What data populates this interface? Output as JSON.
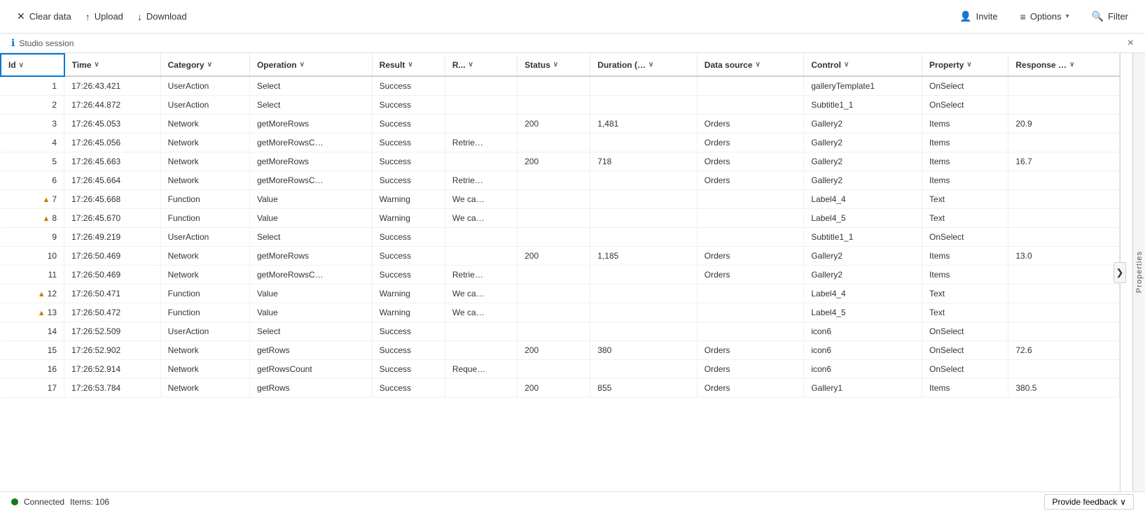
{
  "toolbar": {
    "clear_data_label": "Clear data",
    "upload_label": "Upload",
    "download_label": "Download",
    "invite_label": "Invite",
    "options_label": "Options",
    "filter_label": "Filter"
  },
  "session": {
    "label": "Studio session",
    "close_title": "Close"
  },
  "table": {
    "columns": [
      {
        "key": "id",
        "label": "Id",
        "sortable": true
      },
      {
        "key": "time",
        "label": "Time",
        "sortable": true
      },
      {
        "key": "category",
        "label": "Category",
        "sortable": true
      },
      {
        "key": "operation",
        "label": "Operation",
        "sortable": true
      },
      {
        "key": "result",
        "label": "Result",
        "sortable": true
      },
      {
        "key": "r",
        "label": "R...",
        "sortable": true
      },
      {
        "key": "status",
        "label": "Status",
        "sortable": true
      },
      {
        "key": "duration",
        "label": "Duration (…",
        "sortable": true
      },
      {
        "key": "datasource",
        "label": "Data source",
        "sortable": true
      },
      {
        "key": "control",
        "label": "Control",
        "sortable": true
      },
      {
        "key": "property",
        "label": "Property",
        "sortable": true
      },
      {
        "key": "response",
        "label": "Response …",
        "sortable": true
      }
    ],
    "rows": [
      {
        "id": 1,
        "warn": false,
        "time": "17:26:43.421",
        "category": "UserAction",
        "operation": "Select",
        "result": "Success",
        "r": "",
        "status": "",
        "duration": "",
        "datasource": "",
        "control": "galleryTemplate1",
        "property": "OnSelect",
        "response": ""
      },
      {
        "id": 2,
        "warn": false,
        "time": "17:26:44.872",
        "category": "UserAction",
        "operation": "Select",
        "result": "Success",
        "r": "",
        "status": "",
        "duration": "",
        "datasource": "",
        "control": "Subtitle1_1",
        "property": "OnSelect",
        "response": ""
      },
      {
        "id": 3,
        "warn": false,
        "time": "17:26:45.053",
        "category": "Network",
        "operation": "getMoreRows",
        "result": "Success",
        "r": "",
        "status": "200",
        "duration": "1,481",
        "datasource": "Orders",
        "control": "Gallery2",
        "property": "Items",
        "response": "20.9"
      },
      {
        "id": 4,
        "warn": false,
        "time": "17:26:45.056",
        "category": "Network",
        "operation": "getMoreRowsC…",
        "result": "Success",
        "r": "Retrie…",
        "status": "",
        "duration": "",
        "datasource": "Orders",
        "control": "Gallery2",
        "property": "Items",
        "response": ""
      },
      {
        "id": 5,
        "warn": false,
        "time": "17:26:45.663",
        "category": "Network",
        "operation": "getMoreRows",
        "result": "Success",
        "r": "",
        "status": "200",
        "duration": "718",
        "datasource": "Orders",
        "control": "Gallery2",
        "property": "Items",
        "response": "16.7"
      },
      {
        "id": 6,
        "warn": false,
        "time": "17:26:45.664",
        "category": "Network",
        "operation": "getMoreRowsC…",
        "result": "Success",
        "r": "Retrie…",
        "status": "",
        "duration": "",
        "datasource": "Orders",
        "control": "Gallery2",
        "property": "Items",
        "response": ""
      },
      {
        "id": 7,
        "warn": true,
        "time": "17:26:45.668",
        "category": "Function",
        "operation": "Value",
        "result": "Warning",
        "r": "We ca…",
        "status": "",
        "duration": "",
        "datasource": "",
        "control": "Label4_4",
        "property": "Text",
        "response": ""
      },
      {
        "id": 8,
        "warn": true,
        "time": "17:26:45.670",
        "category": "Function",
        "operation": "Value",
        "result": "Warning",
        "r": "We ca…",
        "status": "",
        "duration": "",
        "datasource": "",
        "control": "Label4_5",
        "property": "Text",
        "response": ""
      },
      {
        "id": 9,
        "warn": false,
        "time": "17:26:49.219",
        "category": "UserAction",
        "operation": "Select",
        "result": "Success",
        "r": "",
        "status": "",
        "duration": "",
        "datasource": "",
        "control": "Subtitle1_1",
        "property": "OnSelect",
        "response": ""
      },
      {
        "id": 10,
        "warn": false,
        "time": "17:26:50.469",
        "category": "Network",
        "operation": "getMoreRows",
        "result": "Success",
        "r": "",
        "status": "200",
        "duration": "1,185",
        "datasource": "Orders",
        "control": "Gallery2",
        "property": "Items",
        "response": "13.0"
      },
      {
        "id": 11,
        "warn": false,
        "time": "17:26:50.469",
        "category": "Network",
        "operation": "getMoreRowsC…",
        "result": "Success",
        "r": "Retrie…",
        "status": "",
        "duration": "",
        "datasource": "Orders",
        "control": "Gallery2",
        "property": "Items",
        "response": ""
      },
      {
        "id": 12,
        "warn": true,
        "time": "17:26:50.471",
        "category": "Function",
        "operation": "Value",
        "result": "Warning",
        "r": "We ca…",
        "status": "",
        "duration": "",
        "datasource": "",
        "control": "Label4_4",
        "property": "Text",
        "response": ""
      },
      {
        "id": 13,
        "warn": true,
        "time": "17:26:50.472",
        "category": "Function",
        "operation": "Value",
        "result": "Warning",
        "r": "We ca…",
        "status": "",
        "duration": "",
        "datasource": "",
        "control": "Label4_5",
        "property": "Text",
        "response": ""
      },
      {
        "id": 14,
        "warn": false,
        "time": "17:26:52.509",
        "category": "UserAction",
        "operation": "Select",
        "result": "Success",
        "r": "",
        "status": "",
        "duration": "",
        "datasource": "",
        "control": "icon6",
        "property": "OnSelect",
        "response": ""
      },
      {
        "id": 15,
        "warn": false,
        "time": "17:26:52.902",
        "category": "Network",
        "operation": "getRows",
        "result": "Success",
        "r": "",
        "status": "200",
        "duration": "380",
        "datasource": "Orders",
        "control": "icon6",
        "property": "OnSelect",
        "response": "72.6"
      },
      {
        "id": 16,
        "warn": false,
        "time": "17:26:52.914",
        "category": "Network",
        "operation": "getRowsCount",
        "result": "Success",
        "r": "Reque…",
        "status": "",
        "duration": "",
        "datasource": "Orders",
        "control": "icon6",
        "property": "OnSelect",
        "response": ""
      },
      {
        "id": 17,
        "warn": false,
        "time": "17:26:53.784",
        "category": "Network",
        "operation": "getRows",
        "result": "Success",
        "r": "",
        "status": "200",
        "duration": "855",
        "datasource": "Orders",
        "control": "Gallery1",
        "property": "Items",
        "response": "380.5"
      }
    ]
  },
  "side_panel": {
    "label": "Properties",
    "arrow": "❯"
  },
  "status_bar": {
    "connected_label": "Connected",
    "items_label": "Items: 106",
    "feedback_label": "Provide feedback"
  }
}
